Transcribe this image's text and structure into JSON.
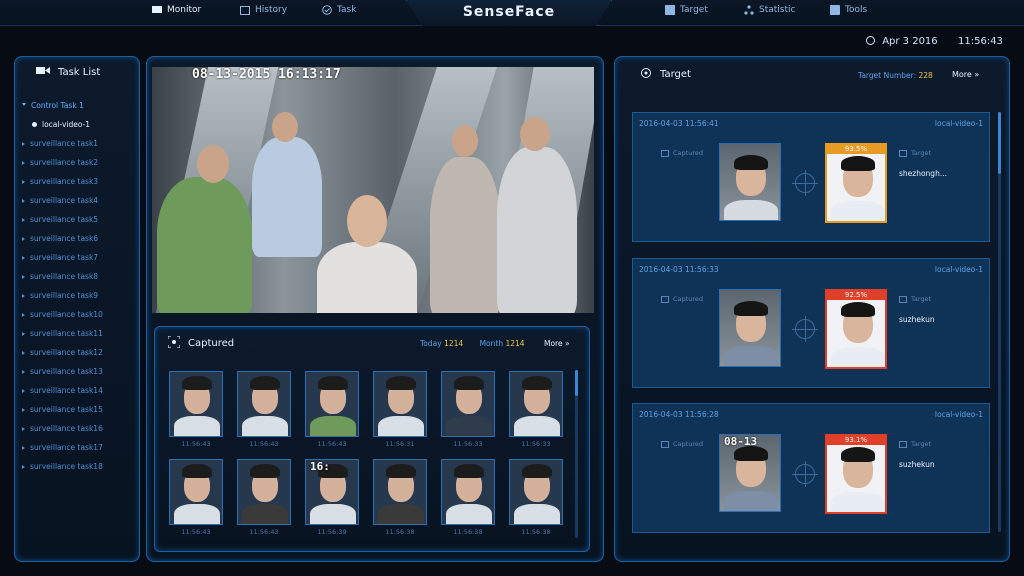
{
  "nav": {
    "brand": "SenseFace",
    "items": [
      "Monitor",
      "History",
      "Task",
      "Target",
      "Statistic",
      "Tools"
    ]
  },
  "datetime": {
    "date": "Apr 3 2016",
    "time": "11:56:43"
  },
  "task_list": {
    "title": "Task List",
    "items": [
      "Control Task 1",
      "local-video-1",
      "surveillance task1",
      "surveillance task2",
      "surveillance task3",
      "surveillance task4",
      "surveillance task5",
      "surveillance task6",
      "surveillance task7",
      "surveillance task8",
      "surveillance task9",
      "surveillance task10",
      "surveillance task11",
      "surveillance task12",
      "surveillance task13",
      "surveillance task14",
      "surveillance task15",
      "surveillance task16",
      "surveillance task17",
      "surveillance task18"
    ]
  },
  "video": {
    "timestamp": "08-13-2015 16:13:17"
  },
  "captured": {
    "title": "Captured",
    "today_label": "Today",
    "today_value": "1214",
    "month_label": "Month",
    "month_value": "1214",
    "more": "More",
    "thumbs": [
      {
        "time": "11:56:43"
      },
      {
        "time": "11:56:43"
      },
      {
        "time": "11:56:43"
      },
      {
        "time": "11:56:31"
      },
      {
        "time": "11:56:33"
      },
      {
        "time": "11:56:33"
      },
      {
        "time": "11:56:43"
      },
      {
        "time": "11:56:43"
      },
      {
        "time": "11:56:39"
      },
      {
        "time": "11:56:38"
      },
      {
        "time": "11:56:38"
      },
      {
        "time": "11:56:38"
      }
    ],
    "overlay": "16:"
  },
  "target": {
    "title": "Target",
    "number_label": "Target Number:",
    "number_value": "228",
    "more": "More",
    "captured_label": "Captured",
    "target_label": "Target",
    "cards": [
      {
        "date": "2016-04-03 11:56:41",
        "source": "local-video-1",
        "score": "93.5%",
        "name": "shezhongh..."
      },
      {
        "date": "2016-04-03 11:56:33",
        "source": "local-video-1",
        "score": "92.5%",
        "name": "suzhekun"
      },
      {
        "date": "2016-04-03 11:56:28",
        "source": "local-video-1",
        "score": "93.1%",
        "name": "suzhekun"
      }
    ],
    "card_overlay": "08-13"
  },
  "colors": {
    "accent": "#3c86d6",
    "highlight": "#f0c23a",
    "alert": "#e0402a",
    "warning": "#e79a24"
  }
}
